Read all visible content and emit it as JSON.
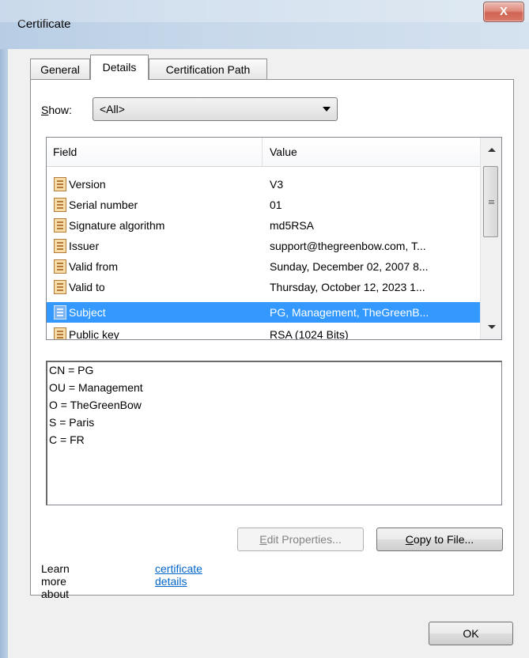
{
  "window": {
    "title": "Certificate",
    "close_glyph": "X"
  },
  "tabs": [
    {
      "label": "General",
      "active": false
    },
    {
      "label": "Details",
      "active": true
    },
    {
      "label": "Certification Path",
      "active": false
    }
  ],
  "show": {
    "label_mnemonic": "S",
    "label_rest": "how:",
    "selected": "<All>"
  },
  "columns": {
    "field": "Field",
    "value": "Value"
  },
  "rows": [
    {
      "field": "Version",
      "value": "V3"
    },
    {
      "field": "Serial number",
      "value": "01"
    },
    {
      "field": "Signature algorithm",
      "value": "md5RSA"
    },
    {
      "field": "Issuer",
      "value": "support@thegreenbow.com, T..."
    },
    {
      "field": "Valid from",
      "value": "Sunday, December 02, 2007 8..."
    },
    {
      "field": "Valid to",
      "value": "Thursday, October 12, 2023 1..."
    },
    {
      "field": "Subject",
      "value": "PG, Management, TheGreenB...",
      "selected": true
    },
    {
      "field": "Public key",
      "value": "RSA (1024 Bits)"
    }
  ],
  "details_lines": [
    "CN = PG",
    "OU = Management",
    "O = TheGreenBow",
    "S = Paris",
    "C = FR"
  ],
  "buttons": {
    "edit_mnemonic": "E",
    "edit_rest": "dit Properties...",
    "copy_mnemonic": "C",
    "copy_rest": "opy to File...",
    "ok": "OK"
  },
  "learn": {
    "prefix": "Learn more about ",
    "link": "certificate details"
  },
  "colors": {
    "selection": "#3399ff",
    "link": "#0066cc",
    "close": "#c7402b"
  },
  "icons": {
    "row_icon": "certificate-field-icon",
    "close": "close-icon"
  }
}
